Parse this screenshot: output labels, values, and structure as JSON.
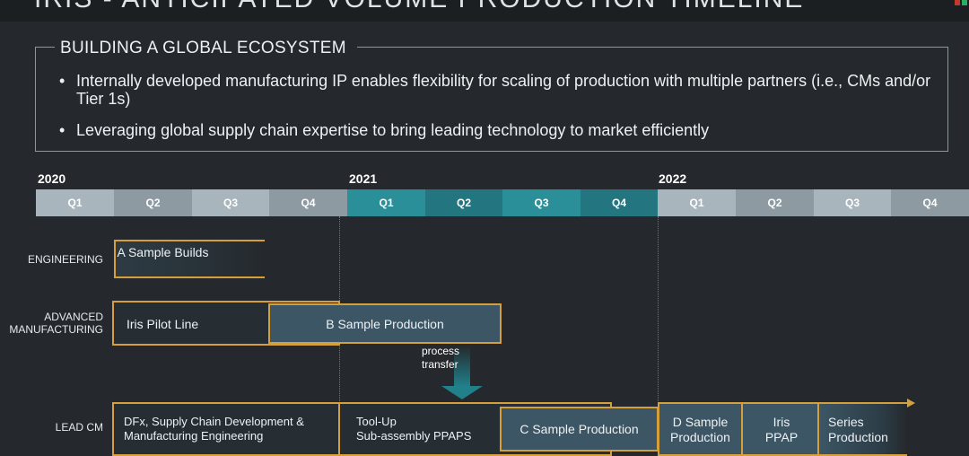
{
  "header": {
    "title": "IRIS - ANTICIPATED VOLUME PRODUCTION TIMELINE"
  },
  "ecosystem": {
    "title": "BUILDING A GLOBAL ECOSYSTEM",
    "bullet_glyph": "•",
    "bullets": [
      "Internally developed manufacturing IP enables flexibility for scaling of production with multiple partners (i.e., CMs and/or Tier 1s)",
      "Leveraging global supply chain expertise to bring leading technology to market efficiently"
    ]
  },
  "timeline": {
    "years": [
      "2020",
      "2021",
      "2022"
    ],
    "quarters": [
      "Q1",
      "Q2",
      "Q3",
      "Q4",
      "Q1",
      "Q2",
      "Q3",
      "Q4",
      "Q1",
      "Q2",
      "Q3",
      "Q4"
    ],
    "quarter_colors": [
      "#a9b5bc",
      "#8d9aa2",
      "#a9b5bc",
      "#8d9aa2",
      "#2a8f99",
      "#237680",
      "#2a8f99",
      "#237680",
      "#a9b5bc",
      "#8d9aa2",
      "#a9b5bc",
      "#8d9aa2"
    ]
  },
  "rows": {
    "engineering": {
      "label": "ENGINEERING",
      "a_sample": "A Sample Builds"
    },
    "advanced": {
      "label_line1": "ADVANCED",
      "label_line2": "MANUFACTURING",
      "pilot_line": "Iris Pilot Line",
      "b_sample": "B Sample Production",
      "process_line1": "process",
      "process_line2": "transfer"
    },
    "lead_cm": {
      "label": "LEAD CM",
      "dfx_line1": "DFx, Supply Chain Development &",
      "dfx_line2": "Manufacturing Engineering",
      "toolup_line1": "Tool-Up",
      "toolup_line2": "Sub-assembly PPAPS",
      "c_sample": "C Sample Production",
      "d_sample_line1": "D Sample",
      "d_sample_line2": "Production",
      "iris_ppap_line1": "Iris",
      "iris_ppap_line2": "PPAP",
      "series_line1": "Series",
      "series_line2": "Production"
    }
  },
  "colors": {
    "accent_border": "#d5a03c",
    "teal": "#21818b",
    "background": "#25292d"
  }
}
